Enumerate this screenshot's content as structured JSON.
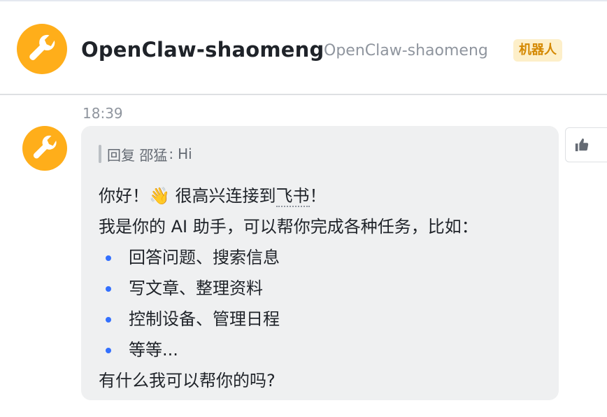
{
  "header": {
    "title": "OpenClaw-shaomeng",
    "subtitle": "OpenClaw-shaomeng",
    "badge": "机器人",
    "avatar_icon": "wrench-icon",
    "avatar_color": "#ffae1a"
  },
  "message": {
    "time": "18:39",
    "reply": {
      "prefix": "回复 邵猛",
      "separator": ":",
      "text": "Hi"
    },
    "greeting_start": "你好！👋 很高兴连接到",
    "greeting_link": "飞书",
    "greeting_end": "！",
    "intro": "我是你的 AI 助手，可以帮你完成各种任务，比如：",
    "items": [
      "回答问题、搜索信息",
      "写文章、整理资料",
      "控制设备、管理日程",
      "等等..."
    ],
    "closing": "有什么我可以帮你的吗?"
  },
  "actions": {
    "like_icon": "thumbs-up-icon"
  },
  "colors": {
    "bubble": "#eff0f1",
    "bullet": "#3370ff",
    "badge_text": "#d48800",
    "badge_bg": "#fdefc9"
  }
}
